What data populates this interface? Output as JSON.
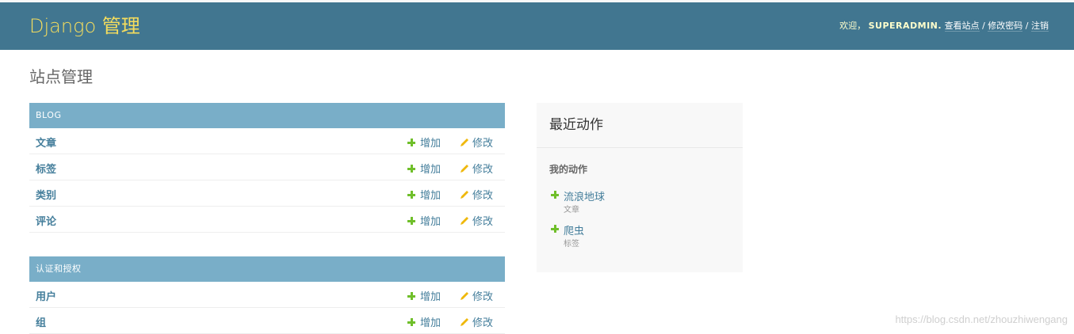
{
  "header": {
    "brand": "Django 管理",
    "welcome": "欢迎，",
    "username": "SUPERADMIN.",
    "view_site": "查看站点",
    "change_password": "修改密码",
    "logout": "注销",
    "separator": "/"
  },
  "page_title": "站点管理",
  "modules": [
    {
      "caption": "BLOG",
      "models": [
        {
          "name": "文章",
          "add": "增加",
          "change": "修改"
        },
        {
          "name": "标签",
          "add": "增加",
          "change": "修改"
        },
        {
          "name": "类别",
          "add": "增加",
          "change": "修改"
        },
        {
          "name": "评论",
          "add": "增加",
          "change": "修改"
        }
      ]
    },
    {
      "caption": "认证和授权",
      "models": [
        {
          "name": "用户",
          "add": "增加",
          "change": "修改"
        },
        {
          "name": "组",
          "add": "增加",
          "change": "修改"
        }
      ]
    }
  ],
  "recent_actions": {
    "title": "最近动作",
    "subtitle": "我的动作",
    "items": [
      {
        "name": "流浪地球",
        "type": "文章",
        "action_icon": "plus-icon"
      },
      {
        "name": "爬虫",
        "type": "标签",
        "action_icon": "plus-icon"
      }
    ]
  },
  "watermark": "https://blog.csdn.net/zhouzhiwengang",
  "colors": {
    "header_bg": "#417690",
    "brand": "#f5dd5d",
    "caption_bg": "#79aec8",
    "link": "#447e9b",
    "add_icon": "#70bf2b",
    "change_icon": "#efb80b",
    "recent_bg": "#f8f8f8"
  }
}
